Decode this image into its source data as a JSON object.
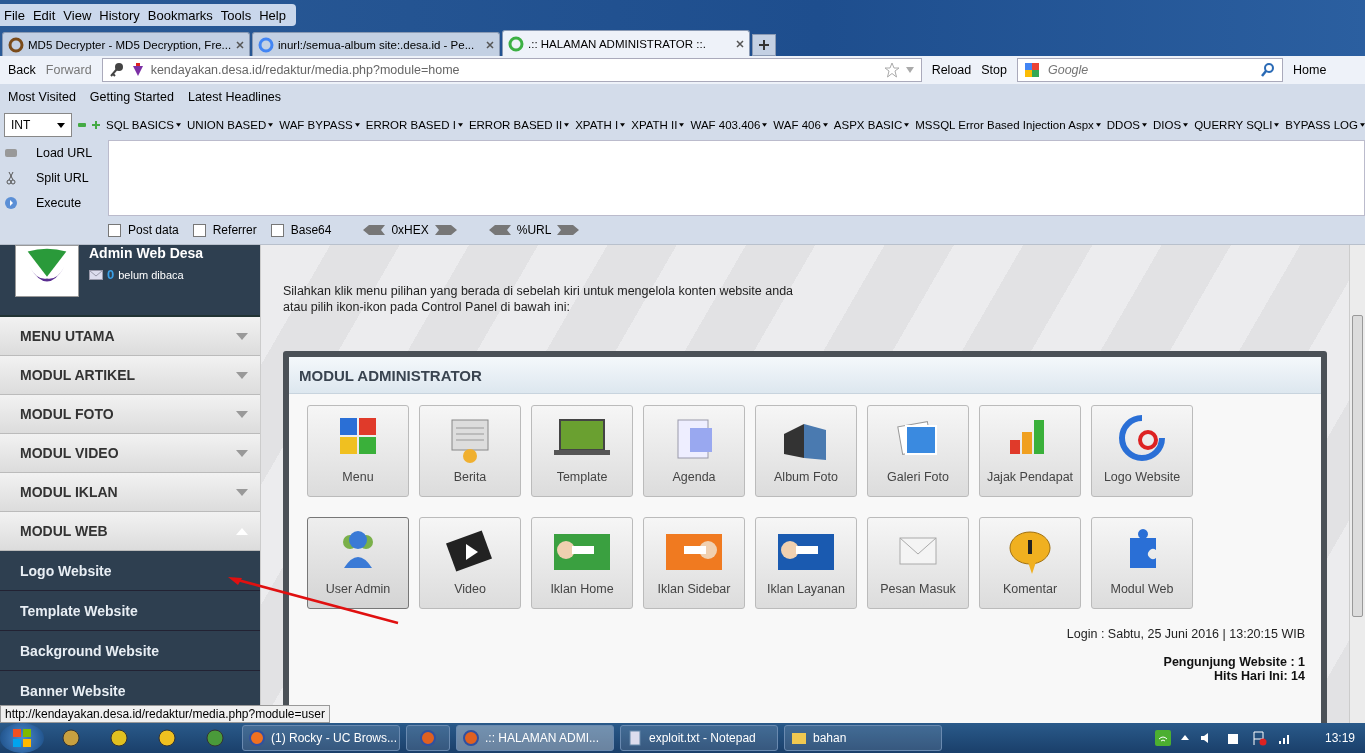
{
  "menu_bar": [
    "File",
    "Edit",
    "View",
    "History",
    "Bookmarks",
    "Tools",
    "Help"
  ],
  "tabs": [
    {
      "label": "MD5 Decrypter - MD5 Decryption, Fre...",
      "selected": false
    },
    {
      "label": "inurl:/semua-album site:.desa.id - Pe...",
      "selected": false
    },
    {
      "label": ".:: HALAMAN ADMINISTRATOR ::.",
      "selected": true
    }
  ],
  "nav": {
    "back": "Back",
    "forward": "Forward",
    "url": "kendayakan.desa.id/redaktur/media.php?module=home",
    "reload": "Reload",
    "stop": "Stop",
    "search_placeholder": "Google",
    "home": "Home"
  },
  "bookmarks": [
    "Most Visited",
    "Getting Started",
    "Latest Headlines"
  ],
  "hackbar": {
    "select": "INT",
    "menus": [
      "SQL BASICS",
      "UNION BASED",
      "WAF BYPASS",
      "ERROR BASED I",
      "ERROR BASED II",
      "XPATH I",
      "XPATH II",
      "WAF 403.406",
      "WAF 406",
      "ASPX BASIC",
      "MSSQL Error Based Injection Aspx",
      "DDOS",
      "DIOS",
      "QUERRY SQLI",
      "BYPASS LOG"
    ],
    "actions": [
      "Load URL",
      "Split URL",
      "Execute"
    ],
    "options": [
      {
        "label": "Post data",
        "checked": false
      },
      {
        "label": "Referrer",
        "checked": false
      },
      {
        "label": "Base64",
        "checked": false
      }
    ],
    "encoders": [
      "0xHEX",
      "%URL"
    ]
  },
  "sidebar": {
    "title": "Admin Web Desa",
    "unread_count": "0",
    "unread_label": "belum dibaca",
    "sections": [
      {
        "label": "MENU UTAMA",
        "expanded": false
      },
      {
        "label": "MODUL ARTIKEL",
        "expanded": false
      },
      {
        "label": "MODUL FOTO",
        "expanded": false
      },
      {
        "label": "MODUL VIDEO",
        "expanded": false
      },
      {
        "label": "MODUL IKLAN",
        "expanded": false
      },
      {
        "label": "MODUL WEB",
        "expanded": true,
        "children": [
          "Logo Website",
          "Template Website",
          "Background Website",
          "Banner Website"
        ]
      }
    ]
  },
  "intro": [
    "Silahkan klik menu pilihan yang berada di sebelah kiri untuk mengelola konten website anda",
    "atau pilih ikon-ikon pada Control Panel di bawah ini:"
  ],
  "panel": {
    "title": "MODUL ADMINISTRATOR",
    "tiles": [
      {
        "label": "Menu",
        "selected": false
      },
      {
        "label": "Berita",
        "selected": false
      },
      {
        "label": "Template",
        "selected": false
      },
      {
        "label": "Agenda",
        "selected": false
      },
      {
        "label": "Album Foto",
        "selected": false
      },
      {
        "label": "Galeri Foto",
        "selected": false
      },
      {
        "label": "Jajak Pendapat",
        "selected": false
      },
      {
        "label": "Logo Website",
        "selected": false
      },
      {
        "label": "User Admin",
        "selected": true
      },
      {
        "label": "Video",
        "selected": false
      },
      {
        "label": "Iklan Home",
        "selected": false
      },
      {
        "label": "Iklan Sidebar",
        "selected": false
      },
      {
        "label": "Iklan Layanan",
        "selected": false
      },
      {
        "label": "Pesan Masuk",
        "selected": false
      },
      {
        "label": "Komentar",
        "selected": false
      },
      {
        "label": "Modul Web",
        "selected": false
      }
    ],
    "login": "Login : Sabtu, 25 Juni 2016 | 13:20:15 WIB",
    "visitors": "Pengunjung Website : 1",
    "hits": "Hits Hari Ini: 14"
  },
  "status_url": "http://kendayakan.desa.id/redaktur/media.php?module=user",
  "taskbar": {
    "windows": [
      {
        "label": "(1) Rocky - UC Brows...",
        "selected": false
      },
      {
        "selected": false
      },
      {
        "label": ".:: HALAMAN ADMI...",
        "selected": true
      },
      {
        "label": "exploit.txt - Notepad",
        "selected": false
      },
      {
        "label": "bahan",
        "selected": false
      }
    ],
    "clock": "13:19"
  }
}
